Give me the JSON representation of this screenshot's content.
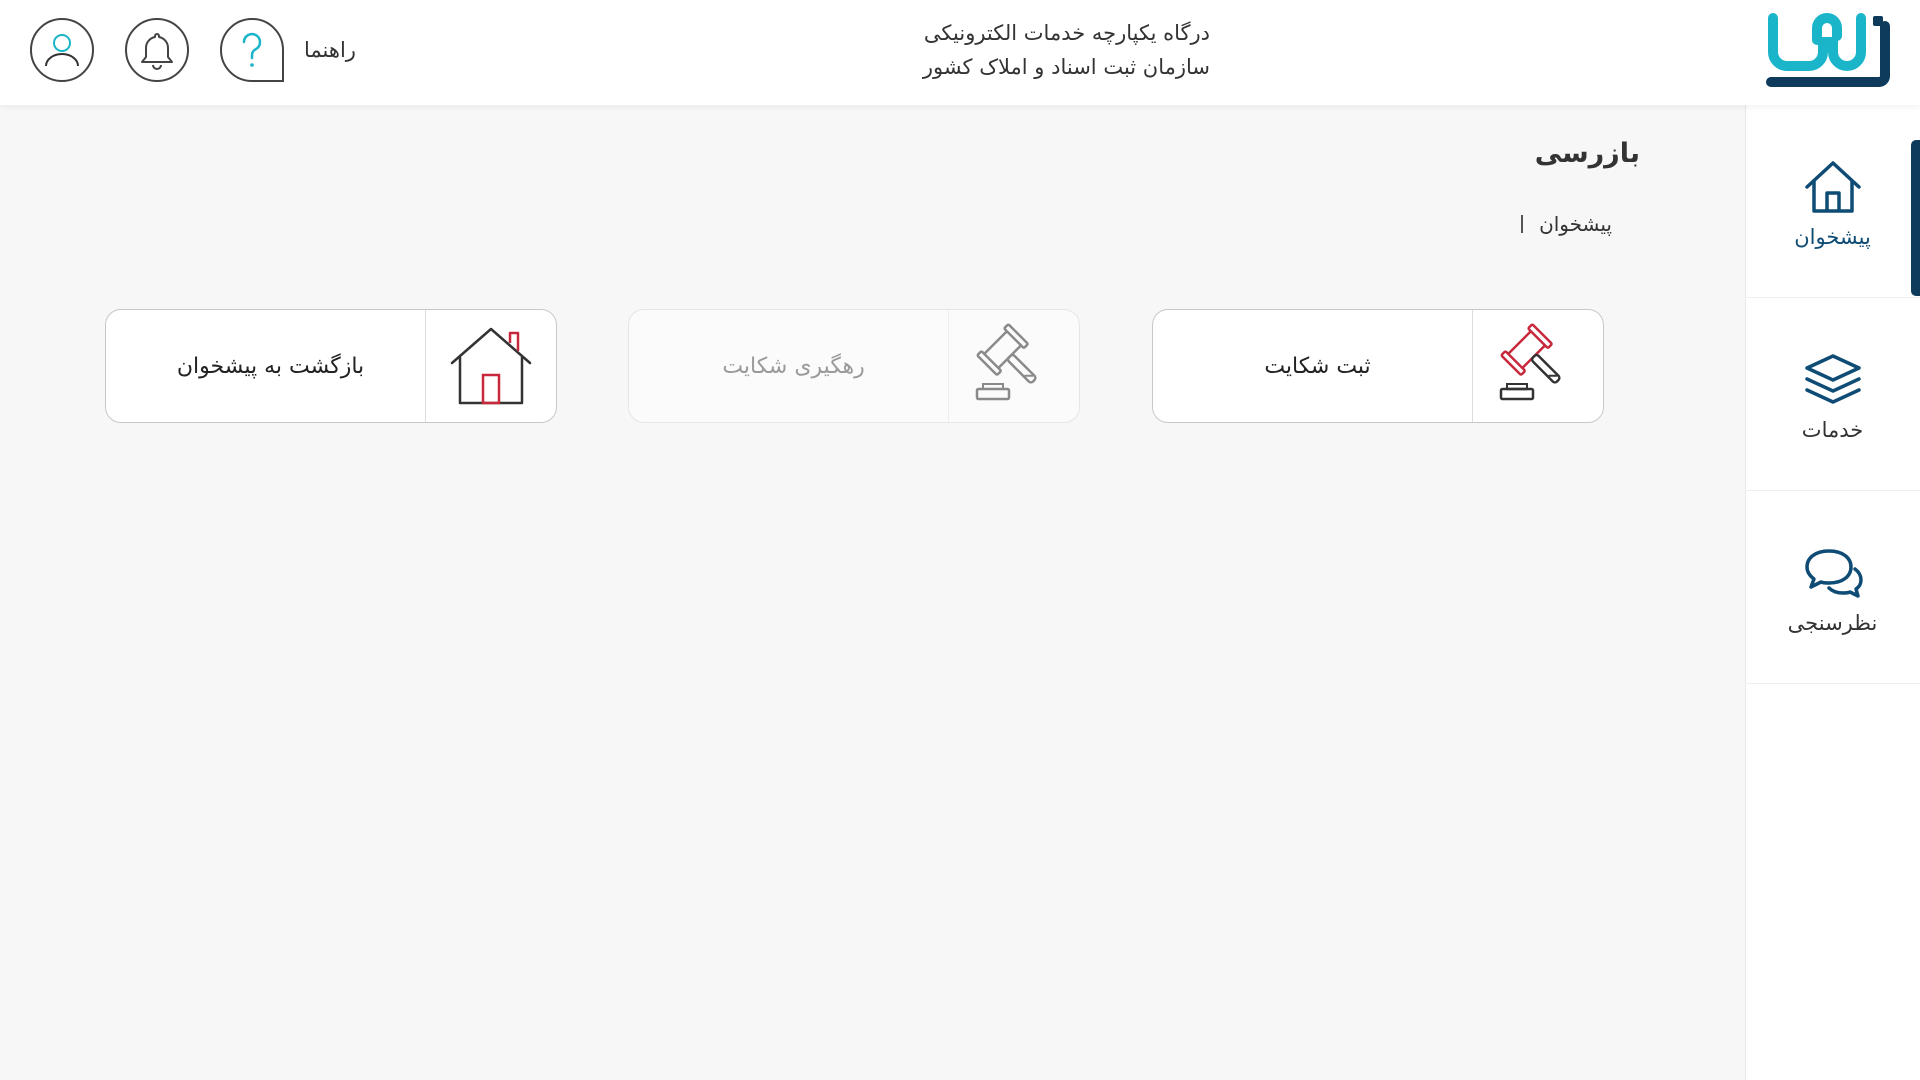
{
  "header": {
    "title_line1": "درگاه یکپارچه خدمات الکترونیکی",
    "title_line2": "سازمان ثبت اسناد و املاک کشور",
    "help_label": "راهنما",
    "logo_icon": "sabt-man-logo",
    "profile_icon": "user-icon",
    "bell_icon": "bell-icon",
    "help_icon": "question-icon"
  },
  "sidebar": {
    "items": [
      {
        "label": "پیشخوان",
        "icon": "home-icon",
        "active": true
      },
      {
        "label": "خدمات",
        "icon": "layers-icon",
        "active": false
      },
      {
        "label": "نظرسنجی",
        "icon": "chat-bubbles-icon",
        "active": false
      }
    ]
  },
  "page": {
    "title": "بازرسی",
    "breadcrumb": "پیشخوان"
  },
  "cards": [
    {
      "label": "ثبت شکایت",
      "icon": "gavel-icon",
      "enabled": true
    },
    {
      "label": "رهگیری شکایت",
      "icon": "gavel-icon",
      "enabled": false
    },
    {
      "label": "بازگشت به پیشخوان",
      "icon": "house-icon",
      "enabled": true
    }
  ],
  "colors": {
    "brand_cyan": "#1ab5c9",
    "brand_navy": "#0e3a5c",
    "accent_red": "#c8283c",
    "background": "#f7f7f7"
  }
}
